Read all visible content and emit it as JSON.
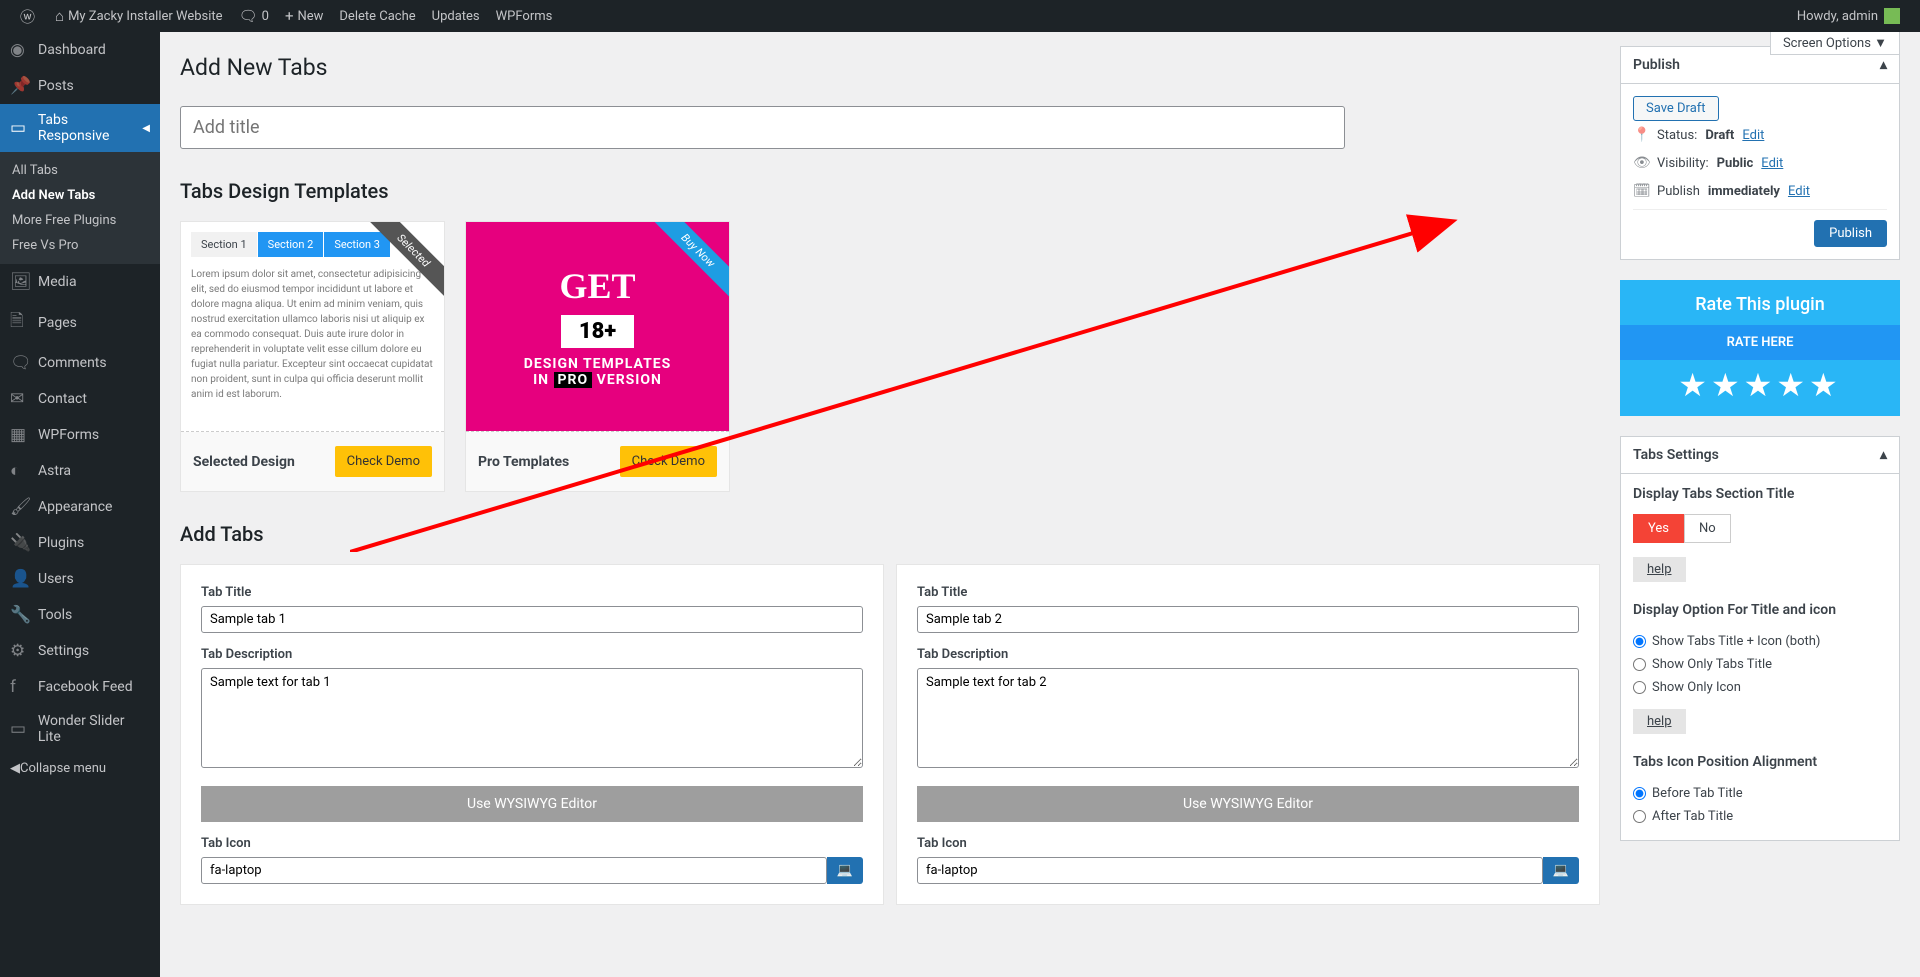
{
  "adminbar": {
    "site_name": "My Zacky Installer Website",
    "comments_count": "0",
    "new_label": "New",
    "delete_cache": "Delete Cache",
    "updates": "Updates",
    "wpforms": "WPForms",
    "howdy": "Howdy, admin"
  },
  "sidemenu": {
    "dashboard": "Dashboard",
    "posts": "Posts",
    "tabs_responsive": "Tabs Responsive",
    "sub_all": "All Tabs",
    "sub_add": "Add New Tabs",
    "sub_more": "More Free Plugins",
    "sub_free": "Free Vs Pro",
    "media": "Media",
    "pages": "Pages",
    "comments": "Comments",
    "contact": "Contact",
    "wpforms": "WPForms",
    "astra": "Astra",
    "appearance": "Appearance",
    "plugins": "Plugins",
    "users": "Users",
    "tools": "Tools",
    "settings": "Settings",
    "fb_feed": "Facebook Feed",
    "wonder": "Wonder Slider Lite",
    "collapse": "Collapse menu"
  },
  "page": {
    "screen_options": "Screen Options ▼",
    "title": "Add New Tabs",
    "title_placeholder": "Add title",
    "templates_heading": "Tabs Design Templates",
    "add_tabs_heading": "Add Tabs"
  },
  "templates": {
    "t1": {
      "ribbon": "Selected",
      "tab1": "Section 1",
      "tab2": "Section 2",
      "tab3": "Section 3",
      "lorem": "Lorem ipsum dolor sit amet, consectetur adipisicing elit, sed do eiusmod tempor incididunt ut labore et dolore magna aliqua. Ut enim ad minim veniam, quis nostrud exercitation ullamco laboris nisi ut aliquip ex ea commodo consequat. Duis aute irure dolor in reprehenderit in voluptate velit esse cillum dolore eu fugiat nulla pariatur. Excepteur sint occaecat cupidatat non proident, sunt in culpa qui officia deserunt mollit anim id est laborum.",
      "footer_label": "Selected Design",
      "button": "Check Demo"
    },
    "t2": {
      "ribbon": "Buy Now",
      "get": "GET",
      "badge": "18+",
      "line1": "DESIGN TEMPLATES",
      "line2a": "IN ",
      "line2b": "PRO",
      "line2c": " VERSION",
      "footer_label": "Pro Templates",
      "button": "Check Demo"
    }
  },
  "tabs": [
    {
      "title_label": "Tab Title",
      "title_value": "Sample tab 1",
      "desc_label": "Tab Description",
      "desc_value": "Sample text for tab 1",
      "wysiwyg": "Use WYSIWYG Editor",
      "icon_label": "Tab Icon",
      "icon_value": "fa-laptop"
    },
    {
      "title_label": "Tab Title",
      "title_value": "Sample tab 2",
      "desc_label": "Tab Description",
      "desc_value": "Sample text for tab 2",
      "wysiwyg": "Use WYSIWYG Editor",
      "icon_label": "Tab Icon",
      "icon_value": "fa-laptop"
    }
  ],
  "publish": {
    "heading": "Publish",
    "save_draft": "Save Draft",
    "status_label": "Status:",
    "status_value": "Draft",
    "visibility_label": "Visibility:",
    "visibility_value": "Public",
    "publish_label": "Publish",
    "publish_value": "immediately",
    "edit": "Edit",
    "publish_btn": "Publish"
  },
  "rate": {
    "heading": "Rate This plugin",
    "button": "RATE HERE",
    "stars": "★★★★★"
  },
  "settings": {
    "heading": "Tabs Settings",
    "display_title": "Display Tabs Section Title",
    "yes": "Yes",
    "no": "No",
    "help": "help",
    "display_option": "Display Option For Title and icon",
    "opt1": "Show Tabs Title + Icon (both)",
    "opt2": "Show Only Tabs Title",
    "opt3": "Show Only Icon",
    "icon_pos": "Tabs Icon Position Alignment",
    "pos1": "Before Tab Title",
    "pos2": "After Tab Title"
  }
}
